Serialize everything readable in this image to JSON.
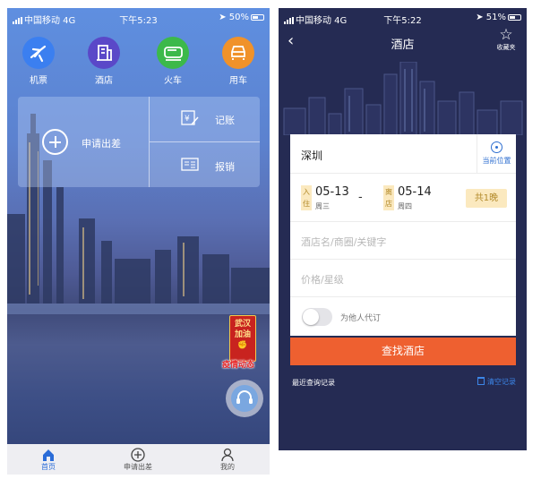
{
  "left": {
    "status": {
      "carrier": "中国移动 4G",
      "time": "下午5:23",
      "battery": "50%",
      "battery_level": 0.5
    },
    "top_icons": [
      {
        "icon": "plane-icon",
        "label": "机票",
        "color": "#3b7ff0"
      },
      {
        "icon": "hotel-icon",
        "label": "酒店",
        "color": "#5a48c8"
      },
      {
        "icon": "train-icon",
        "label": "火车",
        "color": "#3cb94a"
      },
      {
        "icon": "car-icon",
        "label": "用车",
        "color": "#f0922a"
      }
    ],
    "panel": {
      "apply": "申请出差",
      "bookkeeping": "记账",
      "reimburse": "报销"
    },
    "covid": {
      "badge_line1": "武汉",
      "badge_line2": "加油",
      "label": "疫情动态"
    },
    "tabs": [
      {
        "icon": "home-icon",
        "label": "首页"
      },
      {
        "icon": "plus-circle-icon",
        "label": "申请出差"
      },
      {
        "icon": "person-icon",
        "label": "我的"
      }
    ]
  },
  "right": {
    "status": {
      "carrier": "中国移动 4G",
      "time": "下午5:22",
      "battery": "51%",
      "battery_level": 0.51
    },
    "title": "酒店",
    "favorite_label": "收藏夹",
    "city": "深圳",
    "locate_label": "当前位置",
    "checkin": {
      "badge": "入住",
      "date": "05-13",
      "weekday": "周三"
    },
    "checkout": {
      "badge": "离店",
      "date": "05-14",
      "weekday": "周四"
    },
    "nights": "共1晚",
    "keyword_placeholder": "酒店名/商圈/关键字",
    "price_placeholder": "价格/星级",
    "proxy_label": "为他人代订",
    "search_button": "查找酒店",
    "recent_label": "最近查询记录",
    "clear_label": "清空记录"
  },
  "colors": {
    "search_button": "#ee6030",
    "accent_blue": "#2f6fd0",
    "night_badge": "#fbe9bf",
    "hotel_bg": "#252b53"
  }
}
